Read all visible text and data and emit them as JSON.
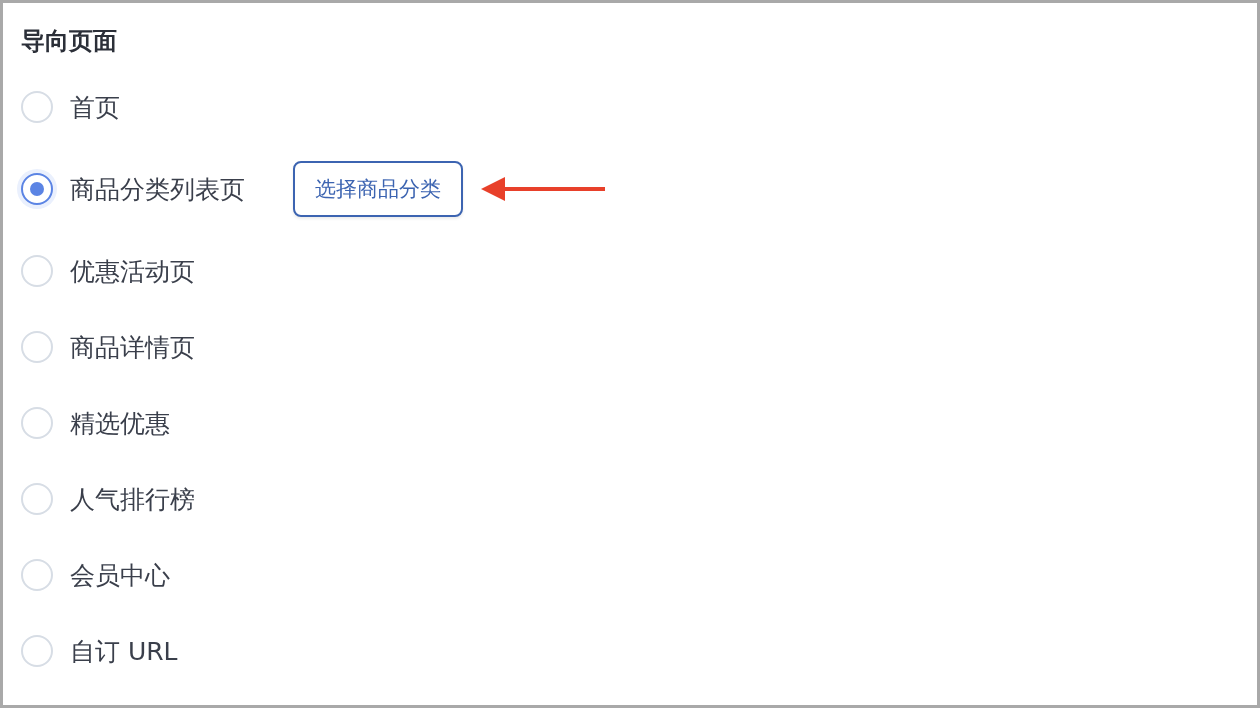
{
  "title": "导向页面",
  "options": [
    {
      "label": "首页",
      "selected": false
    },
    {
      "label": "商品分类列表页",
      "selected": true,
      "action": "选择商品分类"
    },
    {
      "label": "优惠活动页",
      "selected": false
    },
    {
      "label": "商品详情页",
      "selected": false
    },
    {
      "label": "精选优惠",
      "selected": false
    },
    {
      "label": "人气排行榜",
      "selected": false
    },
    {
      "label": "会员中心",
      "selected": false
    },
    {
      "label": "自订 URL",
      "selected": false
    }
  ]
}
